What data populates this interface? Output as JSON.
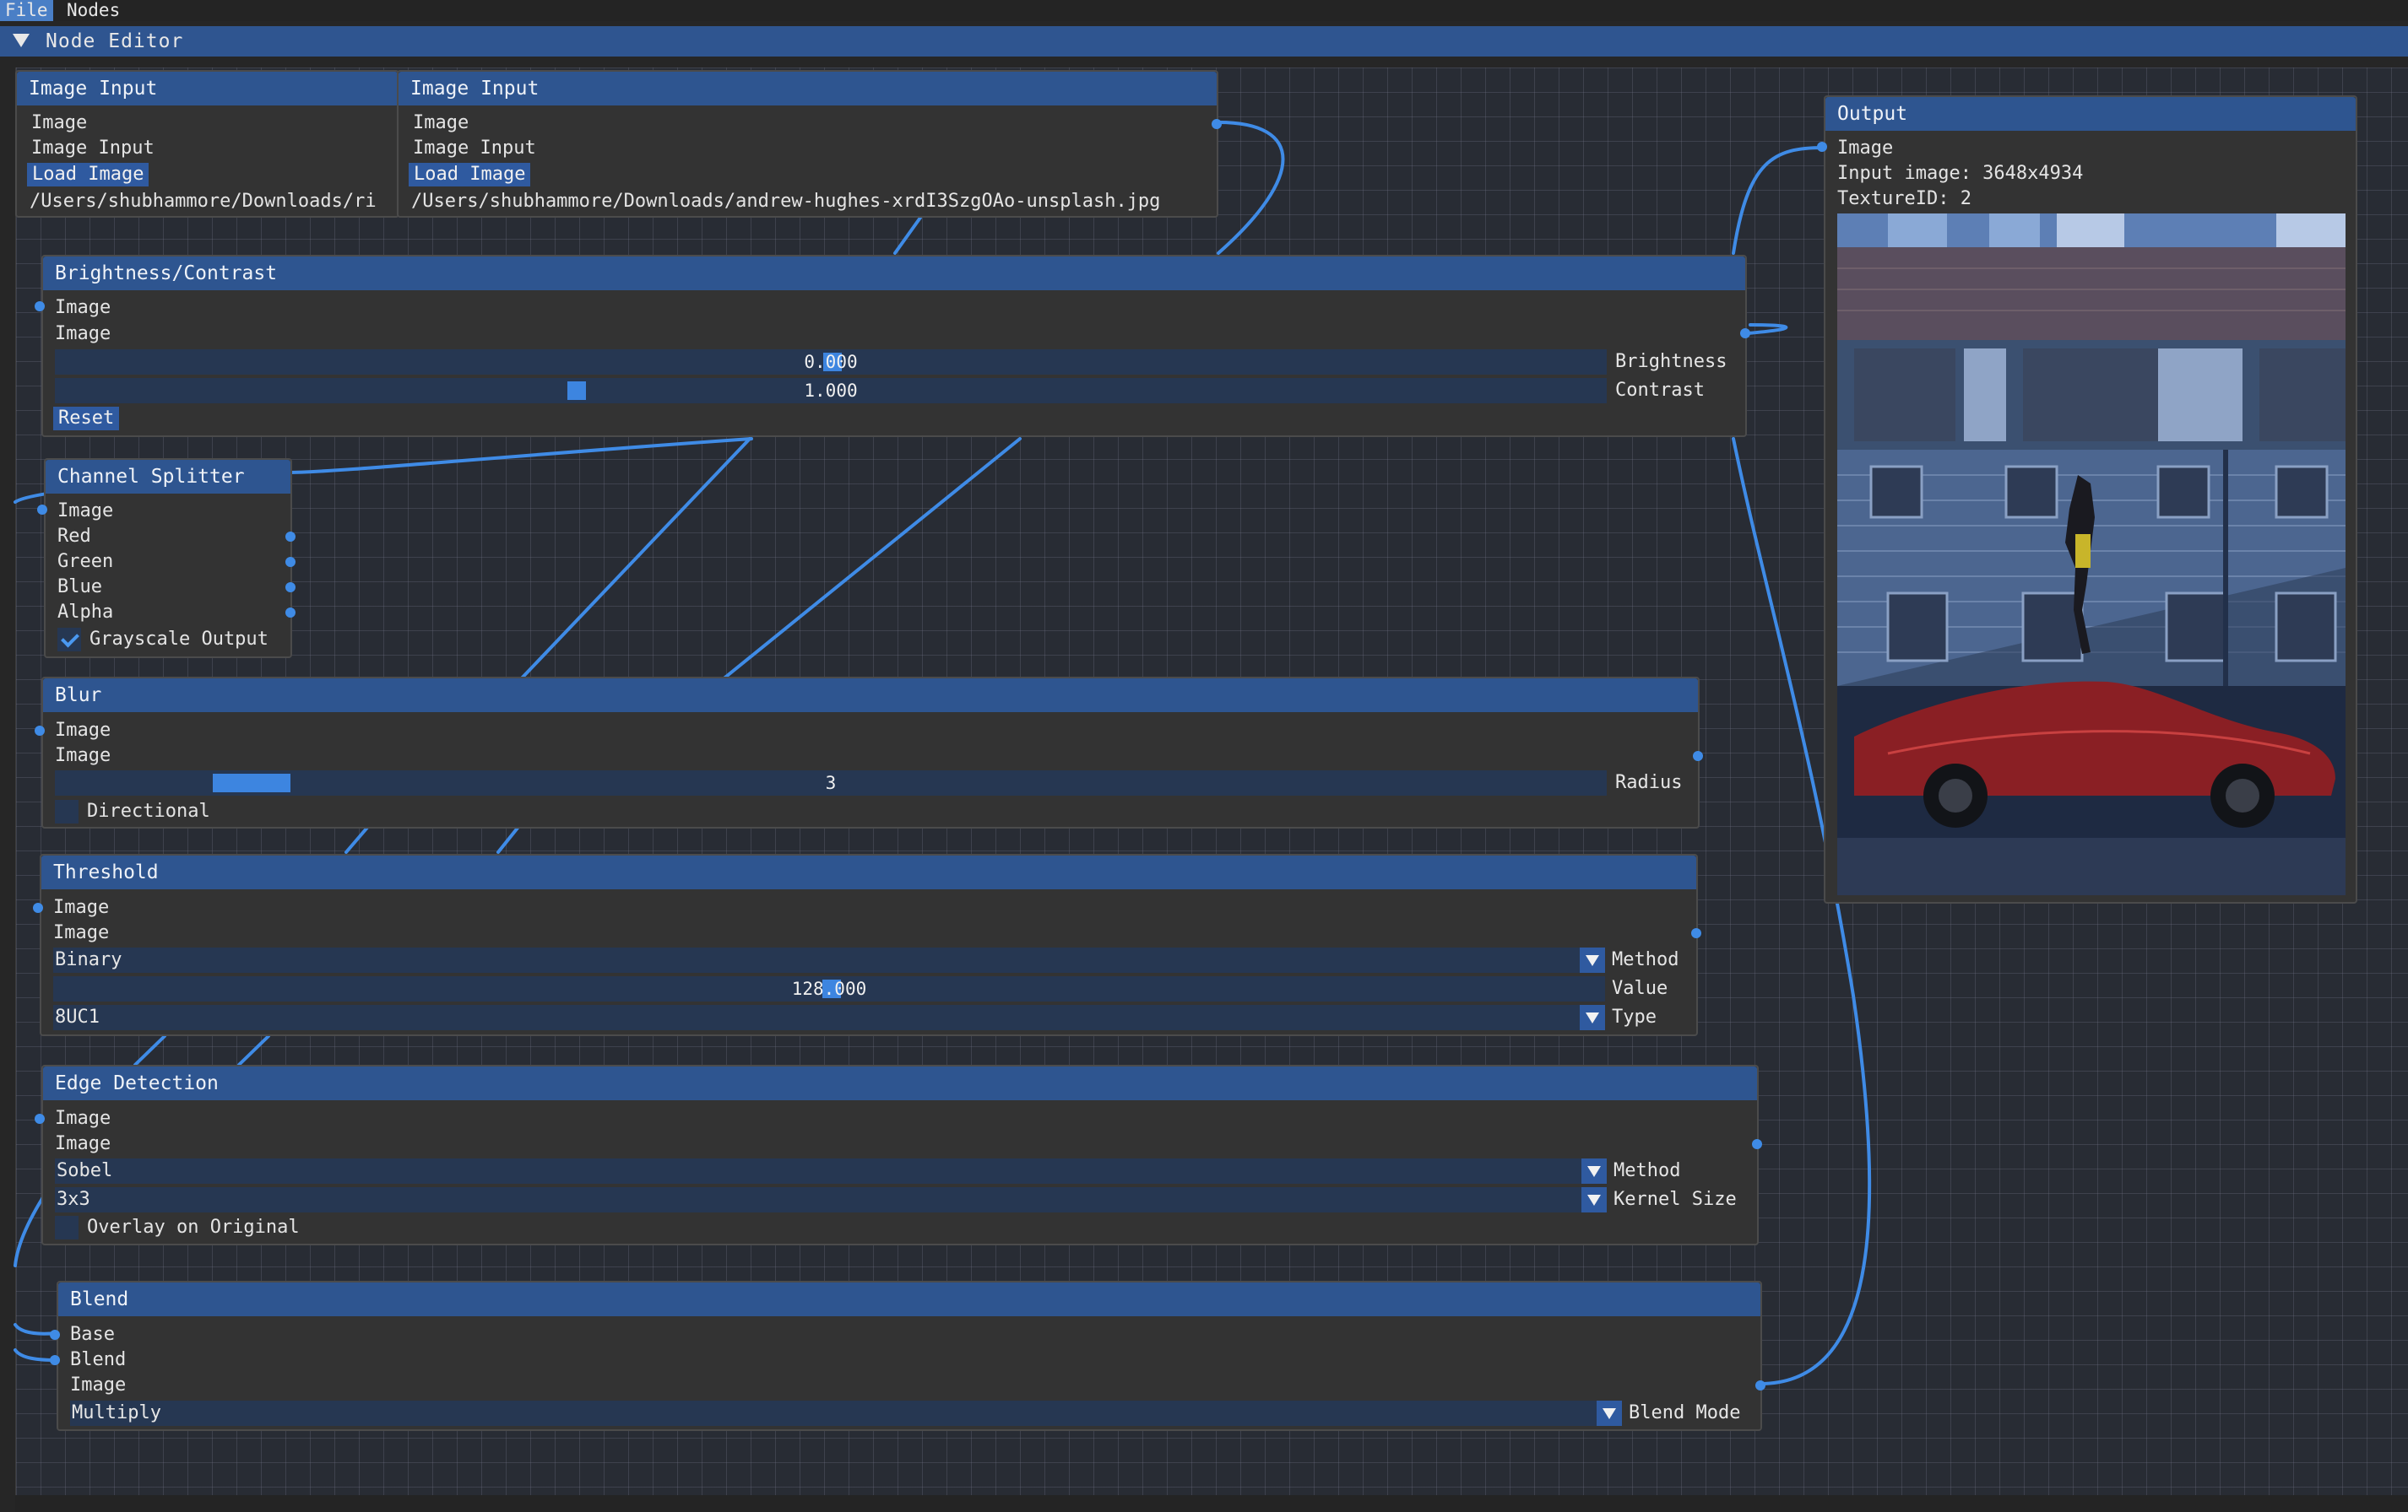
{
  "menu": {
    "file": "File",
    "nodes": "Nodes"
  },
  "window": {
    "title": "Node Editor"
  },
  "image_input_1": {
    "title": "Image Input",
    "out_label": "Image",
    "name": "Image Input",
    "load_button": "Load Image",
    "path": "/Users/shubhammore/Downloads/ri"
  },
  "image_input_2": {
    "title": "Image Input",
    "out_label": "Image",
    "name": "Image Input",
    "load_button": "Load Image",
    "path": "/Users/shubhammore/Downloads/andrew-hughes-xrdI3SzgOAo-unsplash.jpg"
  },
  "brightness": {
    "title": "Brightness/Contrast",
    "in_label": "Image",
    "out_label": "Image",
    "brightness_value": "0.000",
    "brightness_label": "Brightness",
    "contrast_value": "1.000",
    "contrast_label": "Contrast",
    "reset_button": "Reset"
  },
  "splitter": {
    "title": "Channel Splitter",
    "in_label": "Image",
    "outputs": [
      "Red",
      "Green",
      "Blue",
      "Alpha"
    ],
    "grayscale_label": "Grayscale Output",
    "grayscale_checked": true
  },
  "blur": {
    "title": "Blur",
    "in_label": "Image",
    "out_label": "Image",
    "radius_value": "3",
    "radius_label": "Radius",
    "directional_label": "Directional",
    "directional_checked": false
  },
  "threshold": {
    "title": "Threshold",
    "in_label": "Image",
    "out_label": "Image",
    "method_value": "Binary",
    "method_label": "Method",
    "value_value": "128.000",
    "value_label": "Value",
    "type_value": "8UC1",
    "type_label": "Type"
  },
  "edge": {
    "title": "Edge Detection",
    "in_label": "Image",
    "out_label": "Image",
    "method_value": "Sobel",
    "method_label": "Method",
    "kernel_value": "3x3",
    "kernel_label": "Kernel Size",
    "overlay_label": "Overlay on Original",
    "overlay_checked": false
  },
  "blend": {
    "title": "Blend",
    "base_label": "Base",
    "blend_label": "Blend",
    "out_label": "Image",
    "mode_value": "Multiply",
    "mode_label": "Blend Mode"
  },
  "output": {
    "title": "Output",
    "in_label": "Image",
    "info": "Input image: 3648x4934",
    "texture": "TextureID: 2"
  },
  "colors": {
    "accent": "#3f8be6",
    "header": "#2e5590",
    "node_bg": "#333333",
    "canvas_bg": "#282c34"
  }
}
